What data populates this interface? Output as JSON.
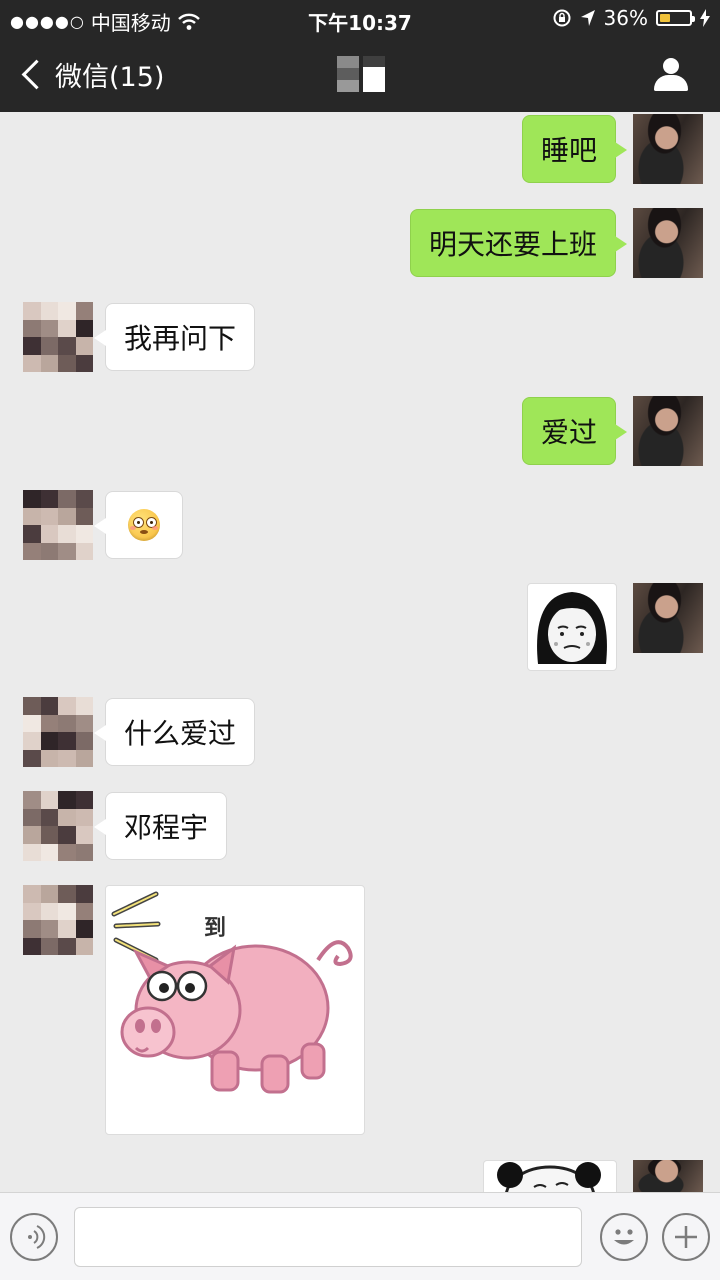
{
  "status_bar": {
    "signal": "●●●●○",
    "carrier": "中国移动",
    "time": "下午10:37",
    "battery": "36%",
    "battery_level": 0.36,
    "icons": [
      "wifi-icon",
      "rotation-lock-icon",
      "location-arrow-icon",
      "charging-bolt-icon"
    ]
  },
  "nav": {
    "back_label": "微信(15)",
    "title": "",
    "profile_icon": "person-icon"
  },
  "messages": [
    {
      "side": "out",
      "type": "text",
      "text": "睡吧"
    },
    {
      "side": "out",
      "type": "text",
      "text": "明天还要上班"
    },
    {
      "side": "in",
      "type": "text",
      "text": "我再问下"
    },
    {
      "side": "out",
      "type": "text",
      "text": "爱过"
    },
    {
      "side": "in",
      "type": "emoji",
      "emoji": "flushed-face-emoji"
    },
    {
      "side": "out",
      "type": "sticker",
      "sticker": "meme-face-girl-sticker"
    },
    {
      "side": "in",
      "type": "text",
      "text": "什么爱过"
    },
    {
      "side": "in",
      "type": "text",
      "text": "邓程宇"
    },
    {
      "side": "in",
      "type": "sticker",
      "sticker": "pig-sticker",
      "caption": "到"
    },
    {
      "side": "out",
      "type": "sticker",
      "sticker": "panda-meme-sticker"
    }
  ],
  "input_bar": {
    "voice_icon": "voice-icon",
    "emoji_icon": "emoji-icon",
    "plus_icon": "plus-icon"
  },
  "colors": {
    "bar_bg": "#272727",
    "chat_bg": "#ebebeb",
    "outgoing_bubble": "#9fe658",
    "incoming_bubble": "#ffffff"
  }
}
